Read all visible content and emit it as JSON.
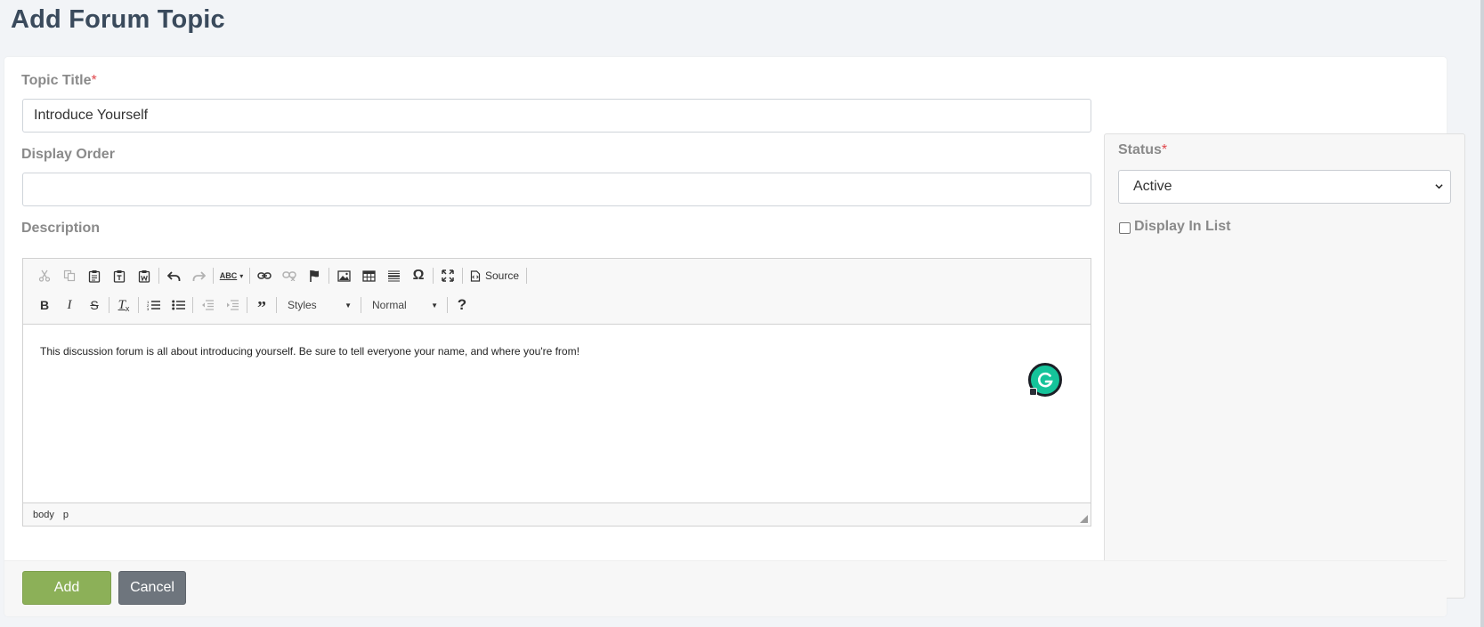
{
  "page": {
    "title": "Add Forum Topic"
  },
  "form": {
    "topic_title": {
      "label": "Topic Title",
      "required_mark": "*",
      "value": "Introduce Yourself"
    },
    "display_order": {
      "label": "Display Order",
      "value": ""
    },
    "description": {
      "label": "Description",
      "content": "This discussion forum is all about introducing yourself. Be sure to tell everyone your name, and where you're from!",
      "toolbar": {
        "row1": [
          "cut-icon",
          "copy-icon",
          "paste-icon",
          "paste-text-icon",
          "paste-word-icon",
          "undo-icon",
          "redo-icon",
          "spellcheck-icon",
          "link-icon",
          "unlink-icon",
          "anchor-icon",
          "image-icon",
          "table-icon",
          "horizontal-line-icon",
          "special-char-icon",
          "maximize-icon"
        ],
        "source_label": "Source",
        "row2": [
          "bold-icon",
          "italic-icon",
          "strikethrough-icon",
          "remove-format-icon",
          "numbered-list-icon",
          "bulleted-list-icon",
          "outdent-icon",
          "indent-icon",
          "blockquote-icon",
          "help-icon"
        ],
        "styles_label": "Styles",
        "format_label": "Normal",
        "spellcheck_glyph": "ABC",
        "special_char_glyph": "Ω",
        "help_glyph": "?"
      },
      "status_path": [
        "body",
        "p"
      ]
    }
  },
  "side": {
    "status": {
      "label": "Status",
      "required_mark": "*",
      "selected": "Active"
    },
    "display_in_list": {
      "label": "Display In List",
      "checked": false
    }
  },
  "actions": {
    "add_label": "Add",
    "cancel_label": "Cancel"
  },
  "colors": {
    "add_button": "#8cb058",
    "cancel_button": "#6e757d",
    "title": "#3a4a5c",
    "grammarly": "#15c39a"
  }
}
